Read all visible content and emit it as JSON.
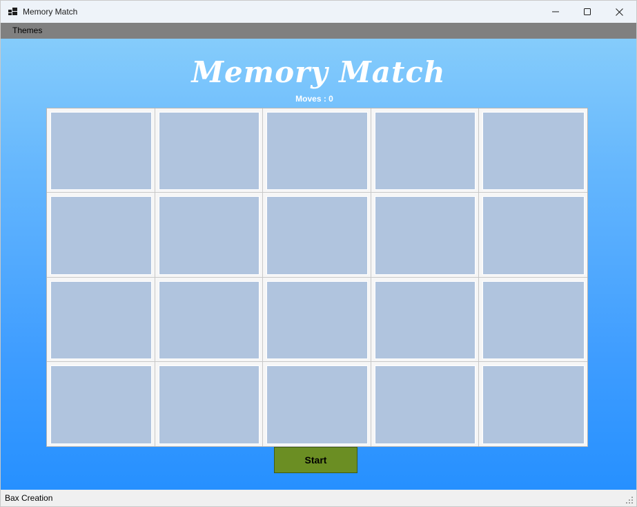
{
  "window": {
    "title": "Memory Match",
    "icon": "windows-app-icon",
    "controls": [
      "minimize-icon",
      "maximize-icon",
      "close-icon"
    ]
  },
  "menubar": {
    "items": [
      {
        "label": "Themes"
      }
    ]
  },
  "game": {
    "title": "Memory Match",
    "moves_label": "Moves : 0",
    "grid": {
      "columns": 5,
      "rows": 4,
      "face_down_cards": 20
    },
    "start_label": "Start"
  },
  "statusbar": {
    "text": "Bax Creation"
  },
  "colors": {
    "card_back": "#b0c4de",
    "background_top": "#85ccfb",
    "background_bottom": "#2690ff",
    "start_button": "#6b8e23",
    "menubar": "#808080"
  }
}
